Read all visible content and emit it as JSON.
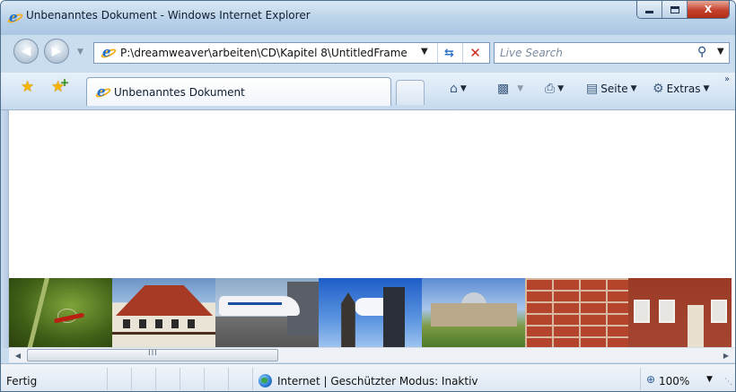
{
  "window": {
    "title": "Unbenanntes Dokument - Windows Internet Explorer",
    "controls": {
      "minimize": "minimize",
      "maximize": "maximize",
      "close": "X"
    }
  },
  "navigation": {
    "back_icon": "back-arrow-icon",
    "forward_icon": "forward-arrow-icon",
    "address": "P:\\dreamweaver\\arbeiten\\CD\\Kapitel 8\\UntitledFrame",
    "search_placeholder": "Live Search"
  },
  "tab": {
    "label": "Unbenanntes Dokument"
  },
  "command_bar": {
    "items": [
      {
        "icon": "home-icon",
        "label": ""
      },
      {
        "icon": "feeds-icon",
        "label": ""
      },
      {
        "icon": "print-icon",
        "label": ""
      },
      {
        "icon": "page-icon",
        "label": "Seite"
      },
      {
        "icon": "tools-icon",
        "label": "Extras"
      }
    ]
  },
  "content": {
    "photos": [
      "dragonfly-photo",
      "half-timbered-house-photo",
      "airplane-photo",
      "church-tower-photo",
      "reichstag-photo",
      "brick-wall-photo",
      "brick-facade-photo"
    ]
  },
  "scrollbar": {
    "grip": "III"
  },
  "status": {
    "text": "Fertig",
    "zone": "Internet | Geschützter Modus: Inaktiv",
    "zoom": "100%"
  }
}
